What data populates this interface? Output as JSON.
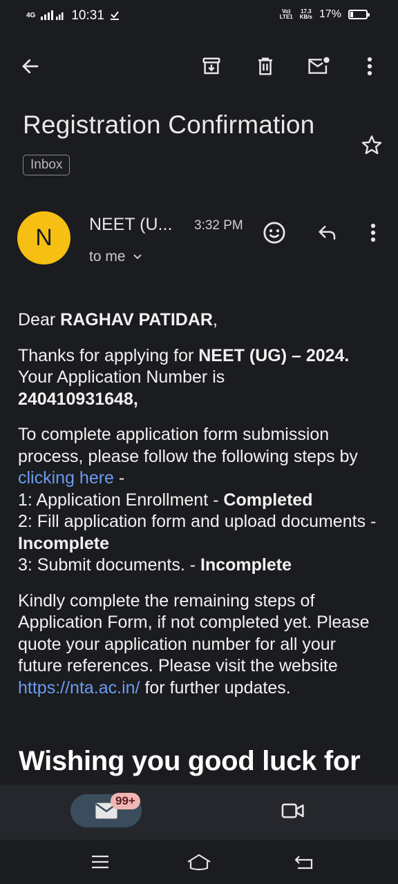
{
  "status_bar": {
    "network": "4G",
    "time": "10:31",
    "lte_top": "Vo)",
    "lte_bottom": "LTE1",
    "speed_value": "17.3",
    "speed_unit": "KB/s",
    "battery": "17%"
  },
  "toolbar": {
    "back_icon": "arrow-left-icon",
    "archive_icon": "archive-icon",
    "delete_icon": "trash-icon",
    "mark_unread_icon": "mail-unread-icon",
    "more_icon": "more-vert-icon"
  },
  "email": {
    "subject": "Registration Confirmation",
    "label": "Inbox",
    "sender_initial": "N",
    "sender_name": "NEET (U...",
    "time": "3:32 PM",
    "recipient": "to me",
    "greeting_prefix": "Dear ",
    "recipient_name": "RAGHAV PATIDAR",
    "greeting_suffix": ",",
    "thanks_prefix": "Thanks for applying for ",
    "exam_name": "NEET (UG) – 2024.",
    "app_number_prefix": "Your Application Number is",
    "app_number": "240410931648",
    "app_number_suffix": ",",
    "steps_intro": "To complete application form submission process, please follow the following steps by ",
    "steps_link": "clicking here",
    "steps_intro_end": " -",
    "step1_text": "1: Application Enrollment - ",
    "step1_status": "Completed",
    "step2_text": "2: Fill application form and upload documents - ",
    "step2_status": "Incomplete",
    "step3_text": "3: Submit documents. - ",
    "step3_status": "Incomplete",
    "closing_part1": "Kindly complete the remaining steps of Application Form, if not completed yet. Please quote your application number for all your future references. Please visit the website ",
    "website_link": "https://nta.ac.in/",
    "closing_part2": " for further updates.",
    "wish": "Wishing you good luck for"
  },
  "bottom_nav": {
    "mail_badge": "99+",
    "mail_icon": "mail-icon",
    "video_icon": "video-icon"
  },
  "colors": {
    "background": "#1b1c1f",
    "avatar": "#f5bf14",
    "link": "#6b9bf0",
    "badge": "#f0b6b4",
    "active_pill": "#3b4d5d"
  }
}
